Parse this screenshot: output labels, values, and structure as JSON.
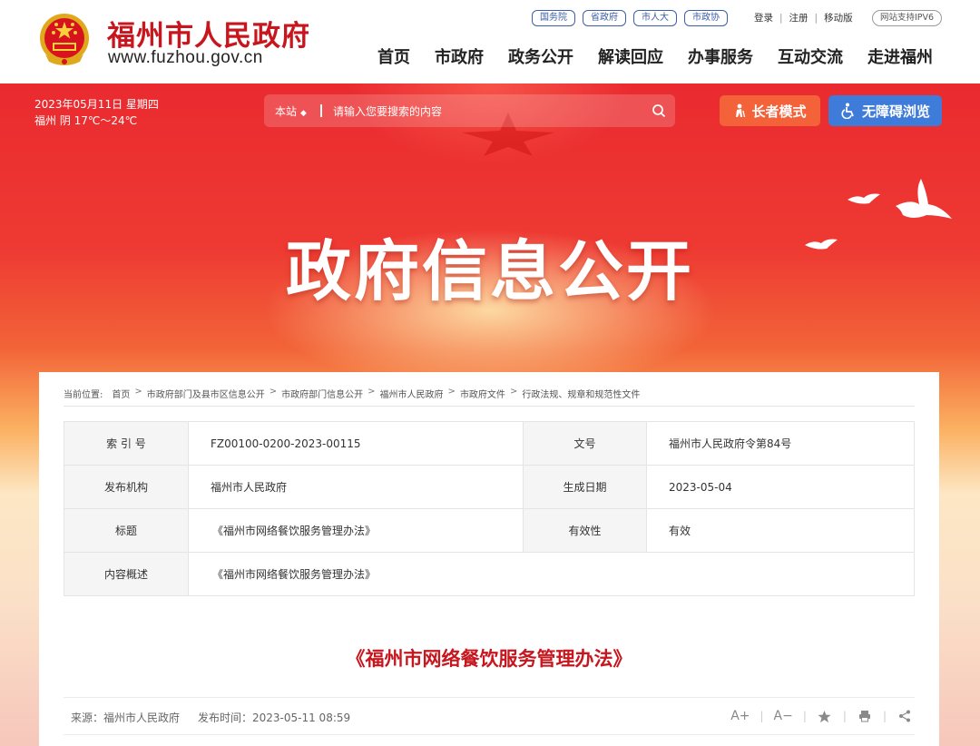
{
  "header": {
    "site_name": "福州市人民政府",
    "site_url": "www.fuzhou.gov.cn",
    "top_links": [
      "国务院",
      "省政府",
      "市人大",
      "市政协"
    ],
    "user_links": [
      "登录",
      "注册",
      "移动版"
    ],
    "ipv6_badge": "网站支持IPV6",
    "nav": [
      "首页",
      "市政府",
      "政务公开",
      "解读回应",
      "办事服务",
      "互动交流",
      "走进福州"
    ]
  },
  "banner": {
    "date_line": "2023年05月11日 星期四",
    "weather_line": "福州 阴 17℃～24℃",
    "search_scope": "本站",
    "search_placeholder": "请输入您要搜索的内容",
    "elder_mode_label": "长者模式",
    "accessibility_label": "无障碍浏览",
    "hero_title": "政府信息公开"
  },
  "breadcrumb": {
    "prefix": "当前位置:",
    "items": [
      "首页",
      "市政府部门及县市区信息公开",
      "市政府部门信息公开",
      "福州市人民政府",
      "市政府文件",
      "行政法规、规章和规范性文件"
    ]
  },
  "meta": {
    "index_no_label": "索 引 号",
    "index_no": "FZ00100-0200-2023-00115",
    "doc_no_label": "文号",
    "doc_no": "福州市人民政府令第84号",
    "publisher_label": "发布机构",
    "publisher": "福州市人民政府",
    "created_label": "生成日期",
    "created": "2023-05-04",
    "title_label": "标题",
    "title": "《福州市网络餐饮服务管理办法》",
    "validity_label": "有效性",
    "validity": "有效",
    "summary_label": "内容概述",
    "summary": "《福州市网络餐饮服务管理办法》"
  },
  "article": {
    "title": "《福州市网络餐饮服务管理办法》",
    "source": "来源：福州市人民政府",
    "publish_time": "发布时间：2023-05-11 08:59",
    "font_larger": "A+",
    "font_smaller": "A−"
  },
  "colors": {
    "brand_red": "#c8161e",
    "elder_button": "#f4623a",
    "accessibility_button": "#3f7bd8",
    "link_blue": "#3b5fa8"
  },
  "icons": [
    "national-emblem-icon",
    "search-icon",
    "elder-icon",
    "wheelchair-icon",
    "star-icon",
    "print-icon",
    "share-icon",
    "dove-icon"
  ]
}
